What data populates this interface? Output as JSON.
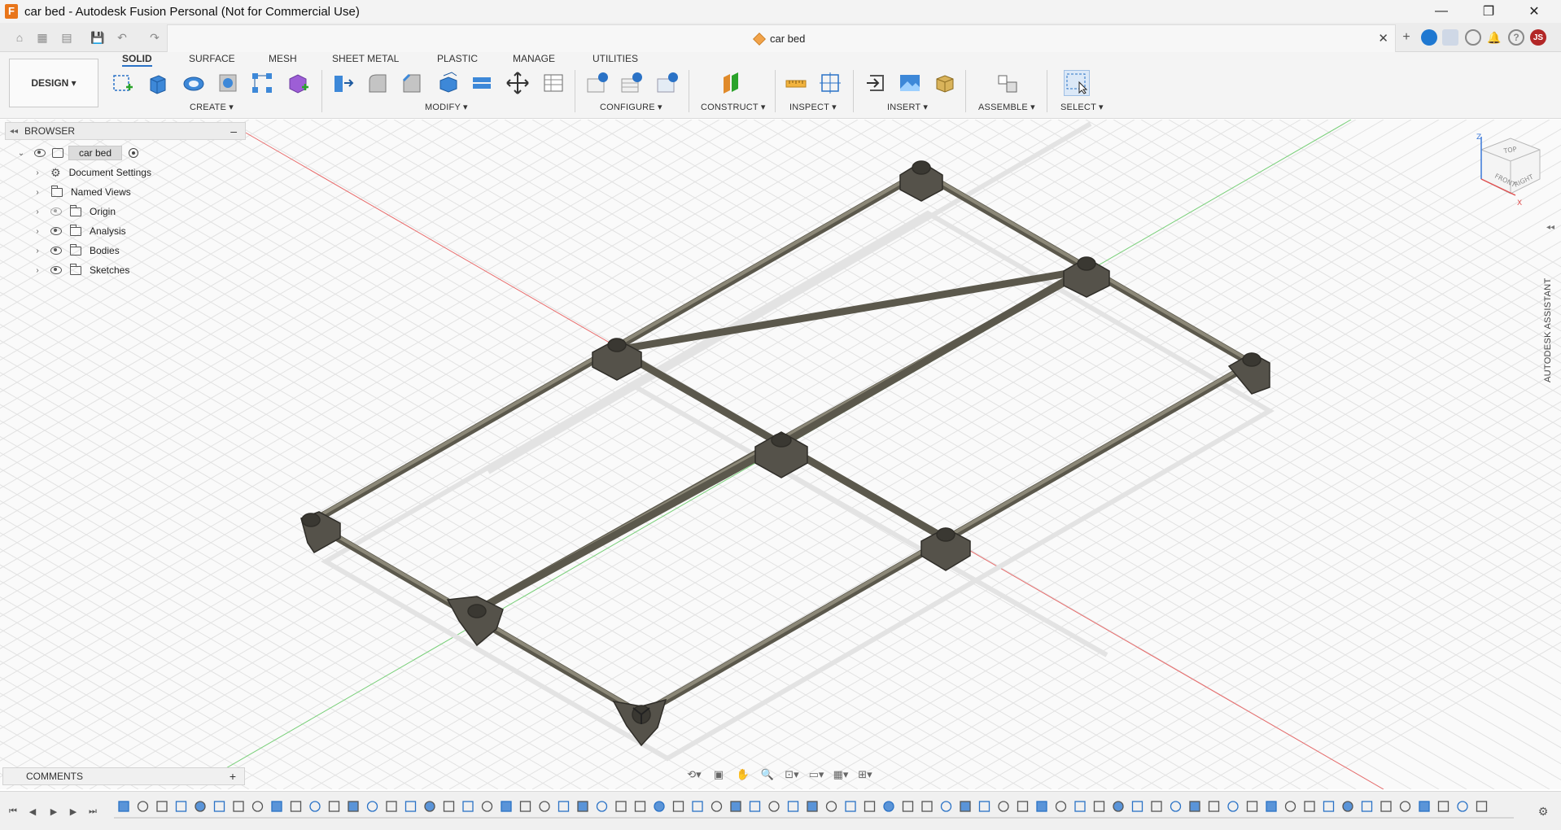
{
  "window": {
    "title": "car bed - Autodesk Fusion Personal (Not for Commercial Use)",
    "app_logo_letter": "F",
    "controls": {
      "minimize": "—",
      "restore": "❐",
      "close": "✕"
    }
  },
  "quick_access": {
    "home": "⌂",
    "apps": "▦",
    "file": "▤",
    "save": "💾",
    "undo": "↶",
    "redo": "↷"
  },
  "document_tab": {
    "name": "car bed",
    "close": "✕"
  },
  "top_right": {
    "new_tab": "+",
    "user_initials": "JS"
  },
  "workspace": {
    "label": "DESIGN ▾"
  },
  "toolbar_tabs": [
    "SOLID",
    "SURFACE",
    "MESH",
    "SHEET METAL",
    "PLASTIC",
    "MANAGE",
    "UTILITIES"
  ],
  "active_tab": "SOLID",
  "groups": {
    "create": "CREATE ▾",
    "modify": "MODIFY ▾",
    "configure": "CONFIGURE ▾",
    "construct": "CONSTRUCT ▾",
    "inspect": "INSPECT ▾",
    "insert": "INSERT ▾",
    "assemble": "ASSEMBLE ▾",
    "select": "SELECT ▾"
  },
  "browser": {
    "title": "BROWSER",
    "collapse": "–",
    "root": "car bed",
    "items": [
      {
        "label": "Document Settings",
        "icon": "gear-icon"
      },
      {
        "label": "Named Views",
        "icon": "folder-icon"
      },
      {
        "label": "Origin",
        "icon": "folder-icon"
      },
      {
        "label": "Analysis",
        "icon": "folder-icon"
      },
      {
        "label": "Bodies",
        "icon": "folder-icon"
      },
      {
        "label": "Sketches",
        "icon": "folder-icon"
      }
    ]
  },
  "comments": {
    "label": "COMMENTS",
    "add": "+"
  },
  "viewcube": {
    "top": "TOP",
    "front": "FRONT",
    "right": "RIGHT",
    "z": "Z",
    "x": "X"
  },
  "assistant": {
    "label": "AUTODESK ASSISTANT"
  },
  "colors": {
    "accent": "#2a72c6",
    "frame": "#7d7a6c",
    "axis_x": "#e05050",
    "axis_y": "#50c050",
    "user_badge": "#b22727"
  }
}
